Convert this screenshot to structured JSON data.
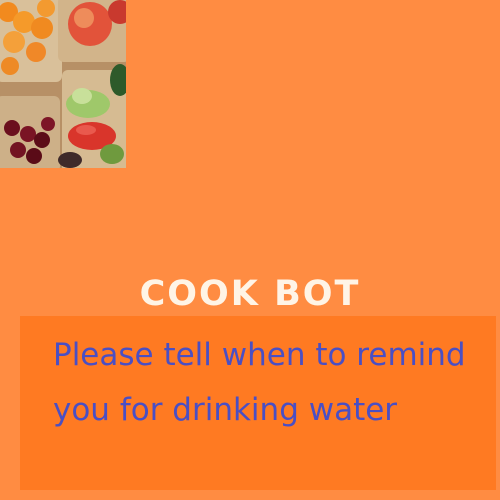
{
  "app": {
    "title": "COOK BOT"
  },
  "hero_image": {
    "icon": "produce-photo"
  },
  "message": {
    "text": "Please tell when to remind you for drinking water"
  },
  "colors": {
    "background": "#ff8c42",
    "message_box": "#ff7a22",
    "title": "#fff4e6",
    "message_text": "#4a4fc4"
  }
}
